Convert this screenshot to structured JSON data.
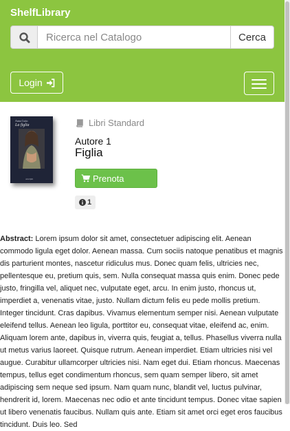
{
  "header": {
    "brand": "ShelfLibrary",
    "search": {
      "placeholder": "Ricerca nel Catalogo",
      "value": "",
      "button_label": "Cerca"
    },
    "login_label": "Login",
    "colors": {
      "bar": "#8cc540"
    }
  },
  "book": {
    "cover": {
      "author": "Anna Cuito",
      "title": "La figlia",
      "footer": "Adelphi"
    },
    "category": "Libri Standard",
    "author": "Autore 1",
    "title": "Figlia",
    "reserve_label": "Prenota",
    "info_count": "1"
  },
  "abstract": {
    "label": "Abstract:",
    "text": "Lorem ipsum dolor sit amet, consectetuer adipiscing elit. Aenean commodo ligula eget dolor. Aenean massa. Cum sociis natoque penatibus et magnis dis parturient montes, nascetur ridiculus mus. Donec quam felis, ultricies nec, pellentesque eu, pretium quis, sem. Nulla consequat massa quis enim. Donec pede justo, fringilla vel, aliquet nec, vulputate eget, arcu. In enim justo, rhoncus ut, imperdiet a, venenatis vitae, justo. Nullam dictum felis eu pede mollis pretium. Integer tincidunt. Cras dapibus. Vivamus elementum semper nisi. Aenean vulputate eleifend tellus. Aenean leo ligula, porttitor eu, consequat vitae, eleifend ac, enim. Aliquam lorem ante, dapibus in, viverra quis, feugiat a, tellus. Phasellus viverra nulla ut metus varius laoreet. Quisque rutrum. Aenean imperdiet. Etiam ultricies nisi vel augue. Curabitur ullamcorper ultricies nisi. Nam eget dui. Etiam rhoncus. Maecenas tempus, tellus eget condimentum rhoncus, sem quam semper libero, sit amet adipiscing sem neque sed ipsum. Nam quam nunc, blandit vel, luctus pulvinar, hendrerit id, lorem. Maecenas nec odio et ante tincidunt tempus. Donec vitae sapien ut libero venenatis faucibus. Nullam quis ante. Etiam sit amet orci eget eros faucibus tincidunt. Duis leo. Sed"
  },
  "icons": {
    "search": "search-icon",
    "login": "sign-in-icon",
    "menu": "hamburger-icon",
    "category": "book-icon",
    "cart": "shopping-cart-icon",
    "info": "info-circle-icon"
  }
}
